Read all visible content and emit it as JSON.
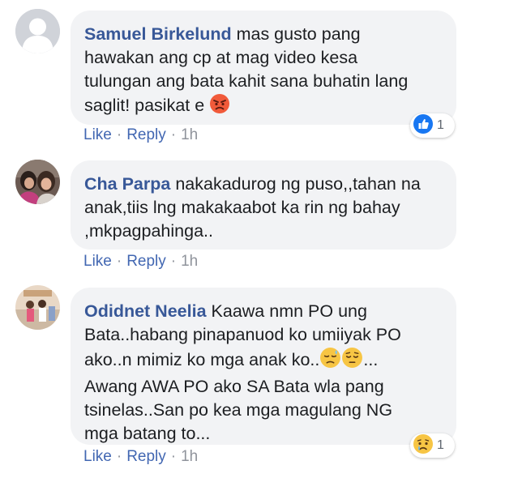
{
  "comments": [
    {
      "author": "Samuel Birkelund",
      "lines": [
        " mas gusto pang",
        "hawakan ang cp at mag video kesa",
        "tulungan ang bata kahit sana buhatin lang",
        "saglit! pasikat e "
      ],
      "emoji_icons": [
        "angry-face-icon"
      ],
      "actions": {
        "like": "Like",
        "reply": "Reply",
        "time": "1h",
        "separator": "·"
      },
      "reaction": {
        "icon": "like-reaction-icon",
        "count": "1"
      }
    },
    {
      "author": "Cha Parpa",
      "lines": [
        " nakakadurog ng puso,,tahan na",
        "anak,tiis lng makakaabot ka rin ng bahay",
        ",mkpagpahinga.."
      ],
      "actions": {
        "like": "Like",
        "reply": "Reply",
        "time": "1h",
        "separator": "·"
      }
    },
    {
      "author": "Odidnet Neelia",
      "lines": [
        " Kaawa nmn PO ung",
        "Bata..habang pinapanuod ko umiiyak PO",
        "ako..n mimiz ko mga anak ko..",
        "Awang AWA PO ako SA Bata wla pang",
        "tsinelas..San po kea mga magulang NG",
        "mga batang to..."
      ],
      "line3_suffix": "...",
      "emoji_icons": [
        "downcast-sweat-face-icon",
        "relieved-face-icon"
      ],
      "actions": {
        "like": "Like",
        "reply": "Reply",
        "time": "1h",
        "separator": "·"
      },
      "reaction": {
        "icon": "sad-reaction-icon",
        "count": "1"
      }
    }
  ],
  "colors": {
    "bubble": "#f2f3f5",
    "author": "#385898",
    "action_link": "#4267b2",
    "meta": "#90949c",
    "like_blue": "#1877f2",
    "angry": "#f15a3a",
    "reaction_yellow": "#f7c544"
  }
}
